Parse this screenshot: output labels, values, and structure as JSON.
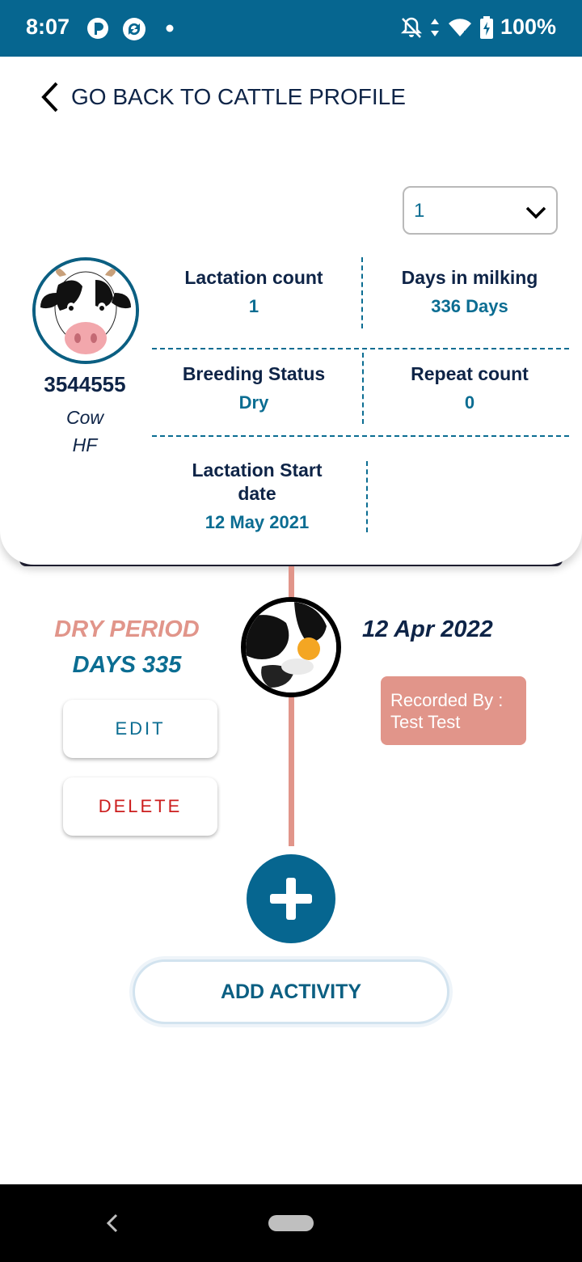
{
  "status_bar": {
    "time": "8:07",
    "battery": "100%",
    "icons": [
      "p-app-icon",
      "sync-icon",
      "dot-icon",
      "bell-off-icon",
      "data-arrows-icon",
      "wifi-icon",
      "battery-charging-icon"
    ]
  },
  "nav": {
    "back_label": "GO BACK TO CATTLE PROFILE"
  },
  "lactation_select": {
    "value": "1"
  },
  "cattle": {
    "id": "3544555",
    "type": "Cow",
    "breed": "HF"
  },
  "stats": {
    "lactation_count": {
      "label": "Lactation count",
      "value": "1"
    },
    "days_in_milking": {
      "label": "Days in milking",
      "value": "336 Days"
    },
    "breeding_status": {
      "label": "Breeding Status",
      "value": "Dry"
    },
    "repeat_count": {
      "label": "Repeat count",
      "value": "0"
    },
    "lactation_start": {
      "label_line1": "Lactation Start",
      "label_line2": "date",
      "value": "12 May 2021"
    }
  },
  "timeline": {
    "event_title": "DRY PERIOD",
    "event_days": "DAYS 335",
    "event_date": "12 Apr 2022",
    "recorded_by_label": "Recorded By :",
    "recorded_by_name": "Test Test",
    "edit_label": "EDIT",
    "delete_label": "DELETE"
  },
  "add_activity_label": "ADD ACTIVITY",
  "colors": {
    "primary": "#066690",
    "accent": "#e1958a",
    "text_dark": "#0e2447",
    "danger": "#cc1d1d"
  }
}
